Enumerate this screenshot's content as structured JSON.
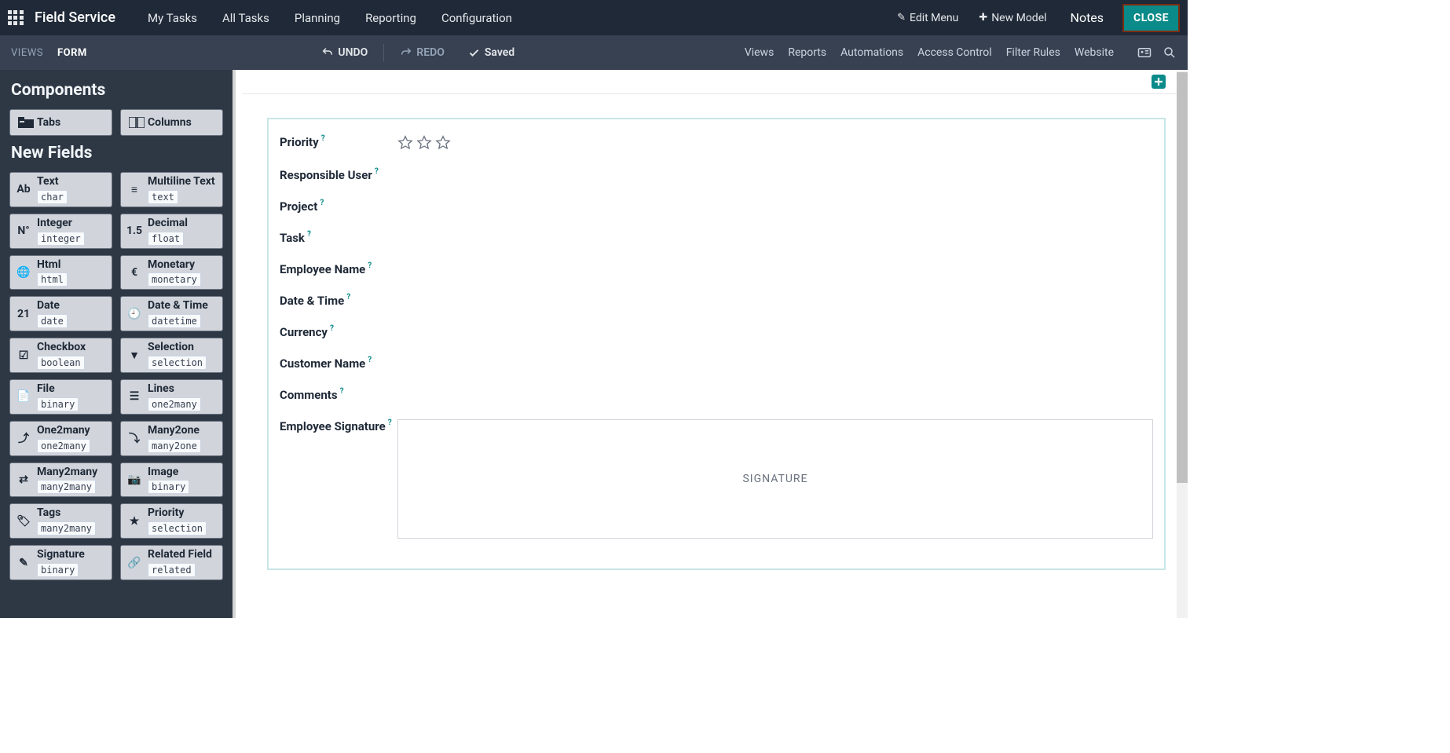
{
  "topbar": {
    "app_title": "Field Service",
    "nav": [
      "My Tasks",
      "All Tasks",
      "Planning",
      "Reporting",
      "Configuration"
    ],
    "edit_menu": "Edit Menu",
    "new_model": "New Model",
    "notes": "Notes",
    "close": "CLOSE"
  },
  "subbar": {
    "views_label": "VIEWS",
    "form_label": "FORM",
    "undo": "UNDO",
    "redo": "REDO",
    "saved": "Saved",
    "tabs": [
      "Views",
      "Reports",
      "Automations",
      "Access Control",
      "Filter Rules",
      "Website"
    ]
  },
  "sidebar": {
    "components_title": "Components",
    "tabs_label": "Tabs",
    "columns_label": "Columns",
    "new_fields_title": "New Fields",
    "fields": [
      {
        "icon": "Ab",
        "name": "Text",
        "type": "char"
      },
      {
        "icon": "≡",
        "name": "Multiline Text",
        "type": "text"
      },
      {
        "icon": "N°",
        "name": "Integer",
        "type": "integer"
      },
      {
        "icon": "1.5",
        "name": "Decimal",
        "type": "float"
      },
      {
        "icon": "🌐",
        "name": "Html",
        "type": "html"
      },
      {
        "icon": "€",
        "name": "Monetary",
        "type": "monetary"
      },
      {
        "icon": "21",
        "name": "Date",
        "type": "date"
      },
      {
        "icon": "🕘",
        "name": "Date & Time",
        "type": "datetime"
      },
      {
        "icon": "☑",
        "name": "Checkbox",
        "type": "boolean"
      },
      {
        "icon": "▼",
        "name": "Selection",
        "type": "selection"
      },
      {
        "icon": "📄",
        "name": "File",
        "type": "binary"
      },
      {
        "icon": "☰",
        "name": "Lines",
        "type": "one2many"
      },
      {
        "icon": "⤴",
        "name": "One2many",
        "type": "one2many"
      },
      {
        "icon": "⤵",
        "name": "Many2one",
        "type": "many2one"
      },
      {
        "icon": "⇄",
        "name": "Many2many",
        "type": "many2many"
      },
      {
        "icon": "📷",
        "name": "Image",
        "type": "binary"
      },
      {
        "icon": "🏷",
        "name": "Tags",
        "type": "many2many"
      },
      {
        "icon": "★",
        "name": "Priority",
        "type": "selection"
      },
      {
        "icon": "✎",
        "name": "Signature",
        "type": "binary"
      },
      {
        "icon": "🔗",
        "name": "Related Field",
        "type": "related"
      }
    ]
  },
  "form": {
    "rows": [
      {
        "label": "Priority",
        "widget": "stars"
      },
      {
        "label": "Responsible User"
      },
      {
        "label": "Project"
      },
      {
        "label": "Task"
      },
      {
        "label": "Employee Name"
      },
      {
        "label": "Date & Time"
      },
      {
        "label": "Currency"
      },
      {
        "label": "Customer Name"
      },
      {
        "label": "Comments"
      },
      {
        "label": "Employee Signature",
        "widget": "signature"
      }
    ],
    "signature_placeholder": "SIGNATURE"
  }
}
